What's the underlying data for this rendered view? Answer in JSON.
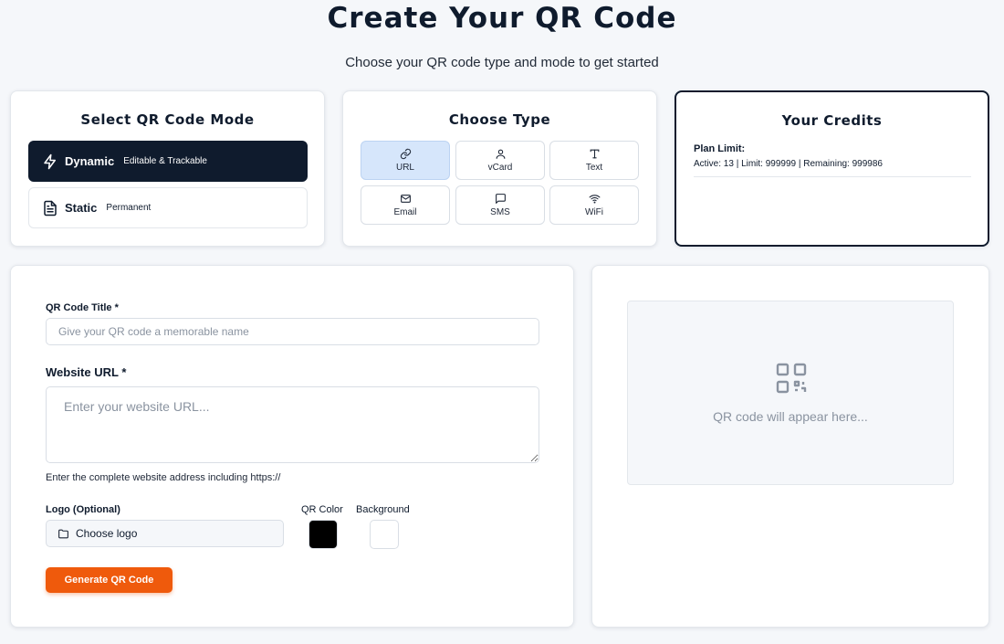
{
  "header": {
    "title": "Create Your QR Code",
    "subtitle": "Choose your QR code type and mode to get started"
  },
  "mode": {
    "title": "Select QR Code Mode",
    "options": [
      {
        "name": "Dynamic",
        "desc": "Editable & Trackable",
        "icon": "lightning-icon",
        "active": true
      },
      {
        "name": "Static",
        "desc": "Permanent",
        "icon": "document-icon",
        "active": false
      }
    ]
  },
  "type": {
    "title": "Choose Type",
    "options": [
      {
        "label": "URL",
        "icon": "link-icon",
        "active": true
      },
      {
        "label": "vCard",
        "icon": "user-icon",
        "active": false
      },
      {
        "label": "Text",
        "icon": "text-icon",
        "active": false
      },
      {
        "label": "Email",
        "icon": "mail-icon",
        "active": false
      },
      {
        "label": "SMS",
        "icon": "chat-icon",
        "active": false
      },
      {
        "label": "WiFi",
        "icon": "wifi-icon",
        "active": false
      }
    ]
  },
  "credits": {
    "title": "Your Credits",
    "plan_label": "Plan Limit:",
    "plan_value": "Active: 13 | Limit: 999999 | Remaining: 999986"
  },
  "form": {
    "title_label": "QR Code Title *",
    "title_placeholder": "Give your QR code a memorable name",
    "url_label": "Website URL *",
    "url_placeholder": "Enter your website URL...",
    "url_helper": "Enter the complete website address including https://",
    "logo_label": "Logo (Optional)",
    "logo_button": "Choose logo",
    "qr_color_label": "QR Color",
    "background_label": "Background",
    "qr_color": "#000000",
    "background_color": "#ffffff",
    "generate_button": "Generate QR Code"
  },
  "preview": {
    "placeholder": "QR code will appear here..."
  },
  "colors": {
    "primary": "#0f1b2d",
    "accent": "#ef5a0c",
    "selected_type": "#d6e6fb"
  }
}
